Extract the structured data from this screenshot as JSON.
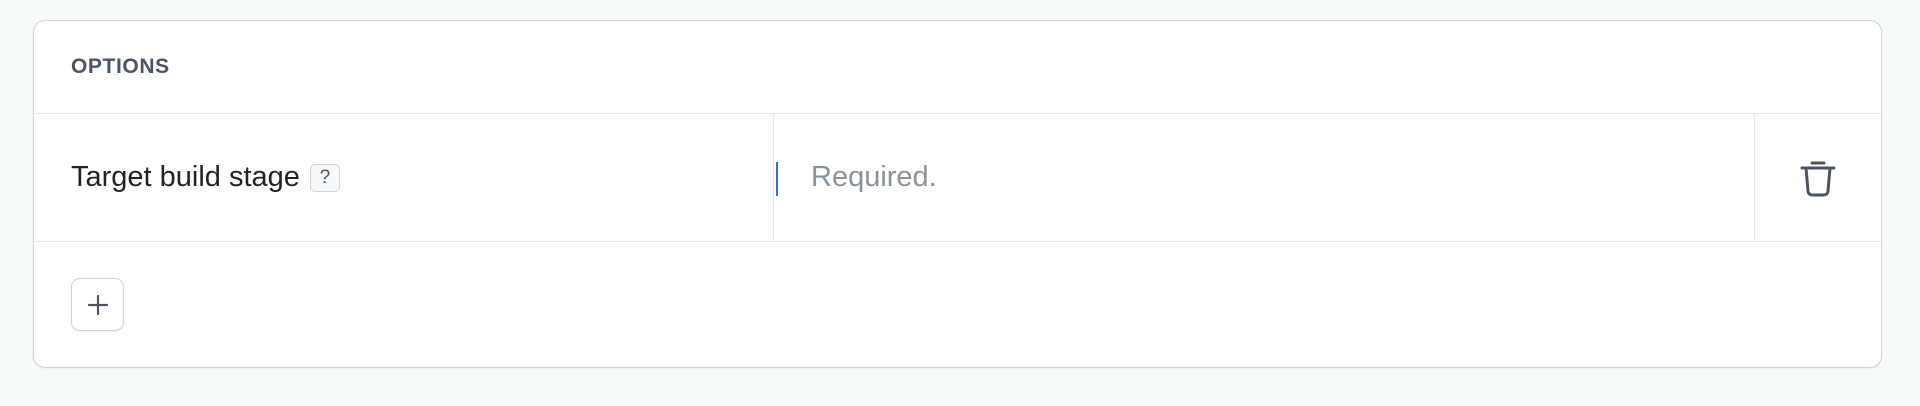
{
  "section": {
    "title": "OPTIONS"
  },
  "options": [
    {
      "label": "Target build stage",
      "help_badge": "?",
      "input_value": "",
      "input_placeholder": "Required.",
      "delete_icon": "trash-icon"
    }
  ],
  "footer": {
    "add_icon": "plus-icon"
  },
  "colors": {
    "accent_caret": "#3b6fd8",
    "text_muted": "#4a5561",
    "border": "#cfd3d8"
  }
}
